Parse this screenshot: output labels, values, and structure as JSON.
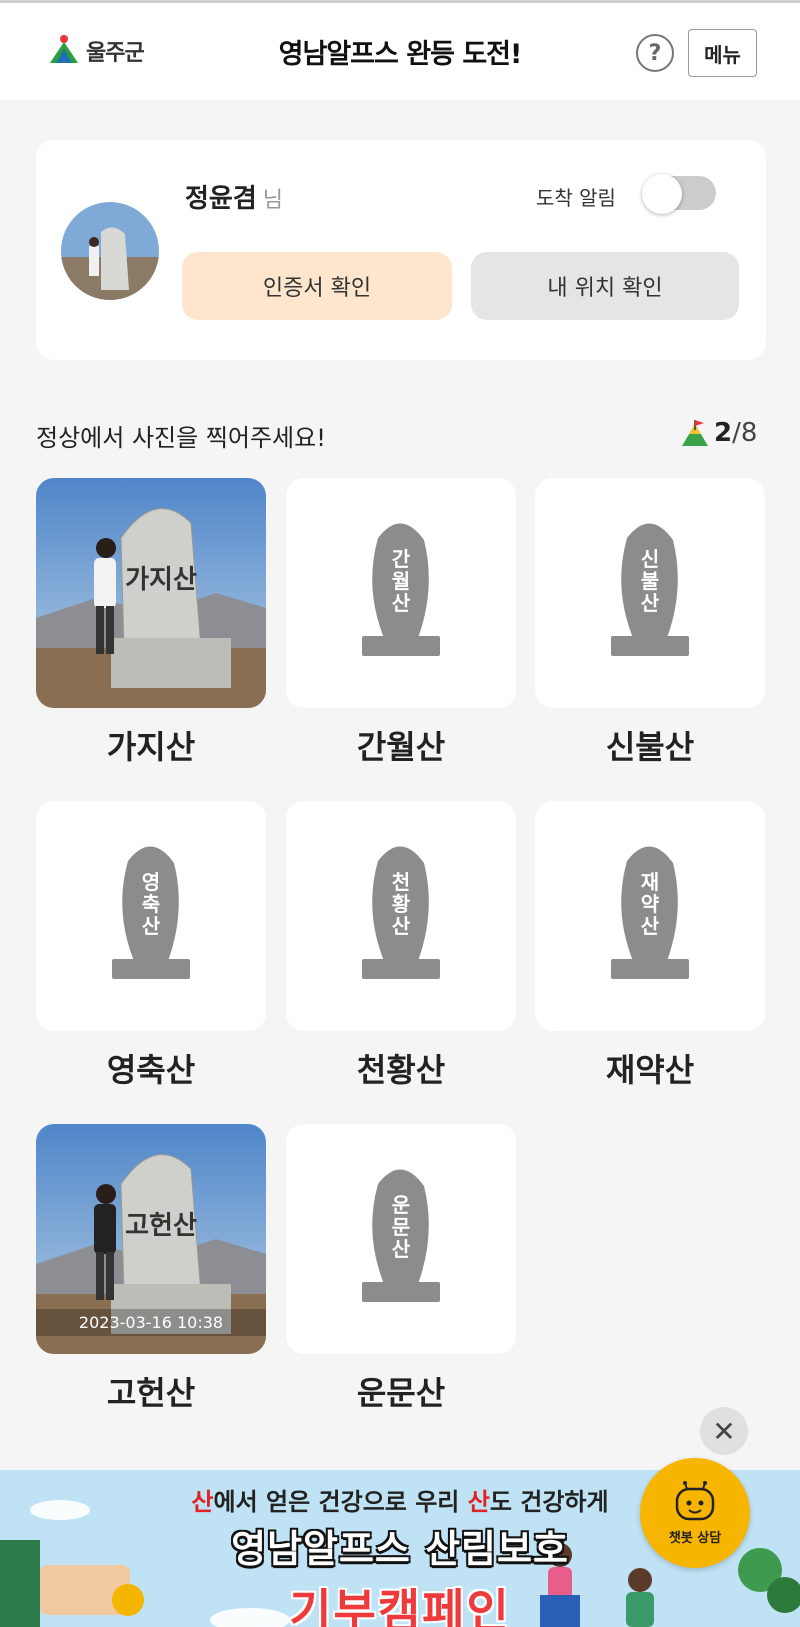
{
  "header": {
    "logo_text": "울주군",
    "title": "영남알프스 완등 도전!",
    "help_label": "?",
    "menu_label": "메뉴"
  },
  "profile": {
    "name": "정윤겸",
    "suffix": "님",
    "alarm_label": "도착 알림",
    "alarm_on": false,
    "cert_button": "인증서 확인",
    "location_button": "내 위치 확인"
  },
  "section": {
    "title": "정상에서 사진을 찍어주세요!",
    "done": "2",
    "sep": "/",
    "total": "8"
  },
  "mountains": [
    {
      "name": "가지산",
      "stone_text": "가지산",
      "completed": true,
      "timestamp": ""
    },
    {
      "name": "간월산",
      "stone_text": "간월산",
      "completed": false,
      "timestamp": ""
    },
    {
      "name": "신불산",
      "stone_text": "신불산",
      "completed": false,
      "timestamp": ""
    },
    {
      "name": "영축산",
      "stone_text": "영축산",
      "completed": false,
      "timestamp": ""
    },
    {
      "name": "천황산",
      "stone_text": "천황산",
      "completed": false,
      "timestamp": ""
    },
    {
      "name": "재약산",
      "stone_text": "재약산",
      "completed": false,
      "timestamp": ""
    },
    {
      "name": "고헌산",
      "stone_text": "고헌산",
      "completed": true,
      "timestamp": "2023-03-16 10:38"
    },
    {
      "name": "운문산",
      "stone_text": "운문산",
      "completed": false,
      "timestamp": ""
    }
  ],
  "close_label": "✕",
  "banner": {
    "line1_a": "산",
    "line1_b": "에서 얻은 건강으로 우리 ",
    "line1_c": "산",
    "line1_d": "도 건강하게",
    "line2": "영남알프스 산림보호",
    "line3": "기부캠페인"
  },
  "chatbot": {
    "label": "챗봇 상담"
  },
  "colors": {
    "accent_peach": "#fde6cd",
    "chat_yellow": "#f7b500",
    "banner_sky": "#bfe3f5"
  }
}
